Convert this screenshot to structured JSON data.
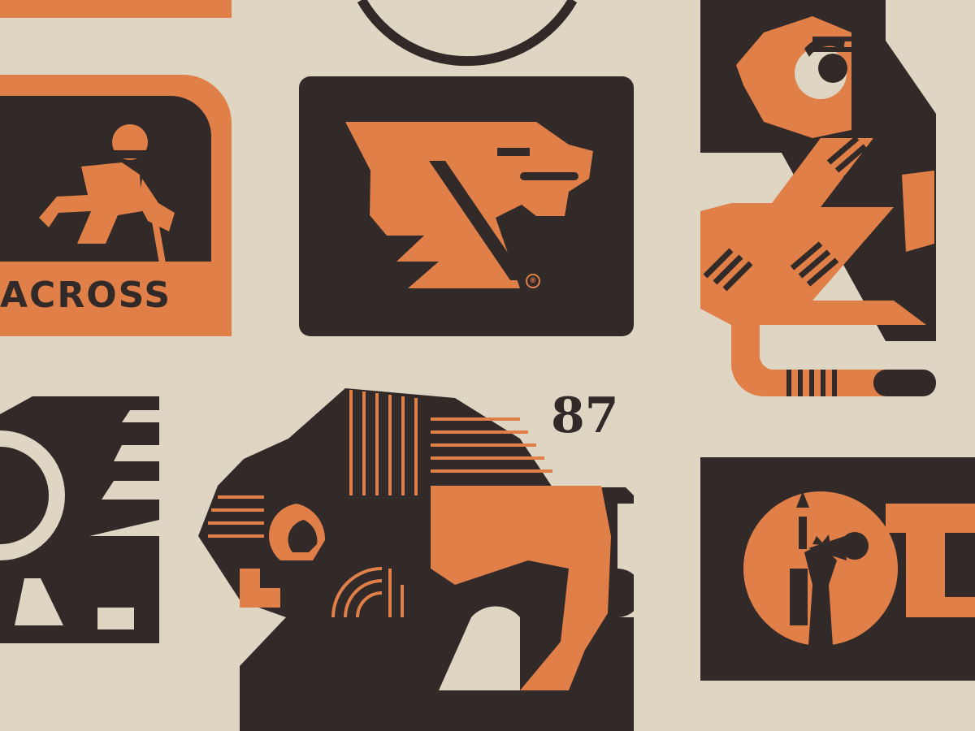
{
  "colors": {
    "background": "#dfd5c3",
    "dark": "#312a28",
    "orange": "#e07f48"
  },
  "logos": {
    "across": {
      "wordmark": "ACROSS",
      "icon": "hiker-icon"
    },
    "dragon": {
      "registered_mark": "®",
      "icon": "dragon-head-icon"
    },
    "lion": {
      "icon": "lion-icon"
    },
    "griffin": {
      "icon": "winged-creature-icon"
    },
    "bison": {
      "number": "87",
      "icon": "bison-icon"
    },
    "ny": {
      "icon": "statue-of-liberty-icon"
    }
  }
}
